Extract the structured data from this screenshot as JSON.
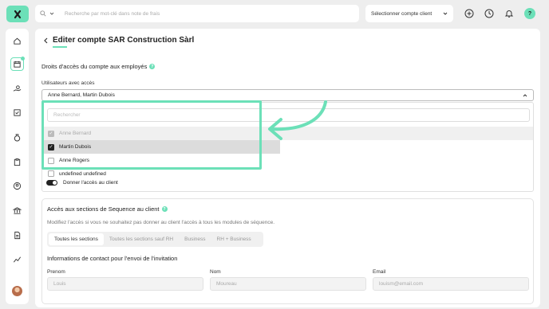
{
  "topbar": {
    "search_placeholder": "Recherche par mot-clé dans note de frais",
    "client_select_label": "Sélectionner compte client",
    "help_label": "?"
  },
  "sidebar": {
    "items": [
      "home",
      "calendar",
      "payments",
      "tasks",
      "money-bag",
      "clipboard",
      "users",
      "bank",
      "document",
      "chart"
    ]
  },
  "page": {
    "title": "Editer compte SAR Construction Sàrl",
    "section_access_title": "Droits d'accès du compte aux employés",
    "users_label": "Utilisateurs avec accès",
    "selected_users": "Anne Bernard, Martin Dubois",
    "dropdown": {
      "search_placeholder": "Rechercher",
      "options": [
        {
          "label": "Anne Bernard",
          "checked": true,
          "disabled": true
        },
        {
          "label": "Martin Dubois",
          "checked": true,
          "disabled": false
        },
        {
          "label": "Anne Rogers",
          "checked": false,
          "disabled": false
        }
      ]
    },
    "undefined_label": "undefined undefined",
    "client_access_label": "Donner l'accès au client",
    "sections_title": "Accès aux sections de Sequence au client",
    "sections_desc": "Modifiez l'accès si vous ne souhaitez pas donner au client l'accès à tous les modules de séquence.",
    "tabs": [
      "Toutes les sections",
      "Toutes les sections sauf RH",
      "Business",
      "RH + Business"
    ],
    "contact_title": "Informations de contact pour l'envoi de l'invitation",
    "fields": {
      "prenom_label": "Prenom",
      "prenom_value": "Louis",
      "nom_label": "Nom",
      "nom_value": "Moureau",
      "email_label": "Email",
      "email_value": "louism@email.com"
    }
  },
  "colors": {
    "accent": "#6ce0b8",
    "dark": "#222222"
  }
}
